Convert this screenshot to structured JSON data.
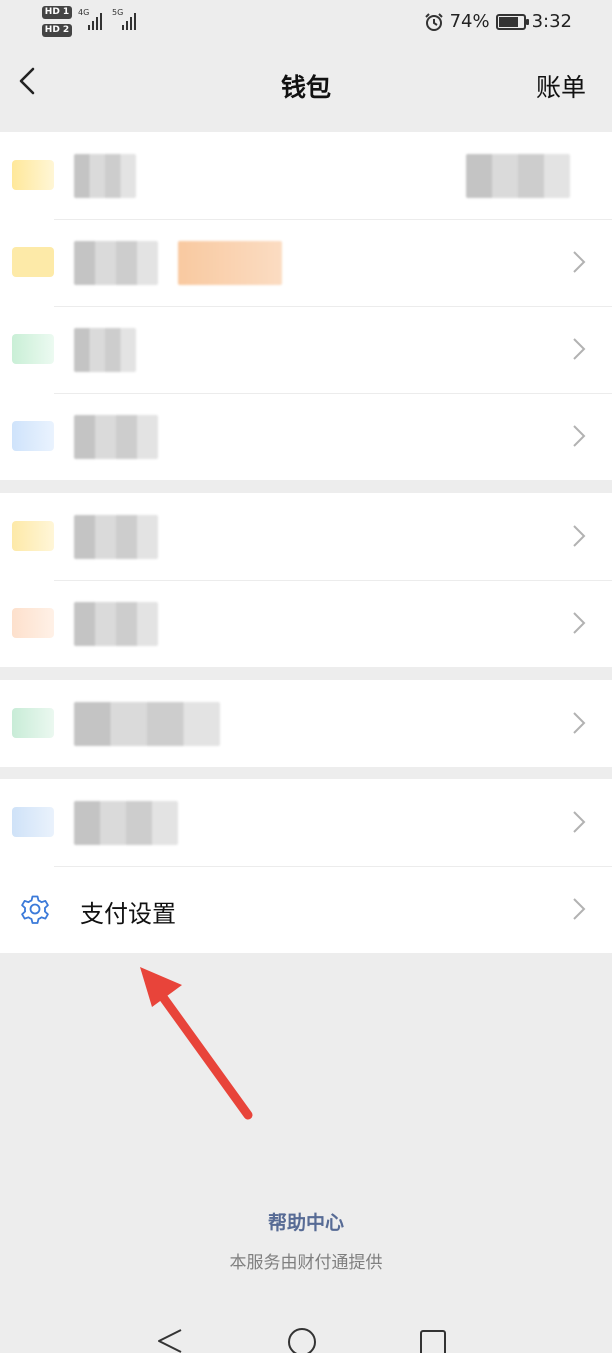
{
  "status_bar": {
    "sim1": "HD 1",
    "sim2": "HD 2",
    "network1": "4G",
    "network2": "5G",
    "battery_percent": "74%",
    "battery_level": 0.74,
    "time": "3:32",
    "icons": [
      "alarm-icon",
      "battery-icon",
      "signal-icon"
    ]
  },
  "nav": {
    "back_icon": "chevron-left-icon",
    "title": "钱包",
    "bill_label": "账单"
  },
  "list": {
    "pay_settings_label": "支付设置",
    "pay_settings_icon": "gear-icon"
  },
  "footer": {
    "help_label": "帮助中心",
    "provider_text": "本服务由财付通提供"
  },
  "colors": {
    "link": "#576b95",
    "arrow": "#e8443a",
    "settings_icon": "#3b7ad9"
  }
}
